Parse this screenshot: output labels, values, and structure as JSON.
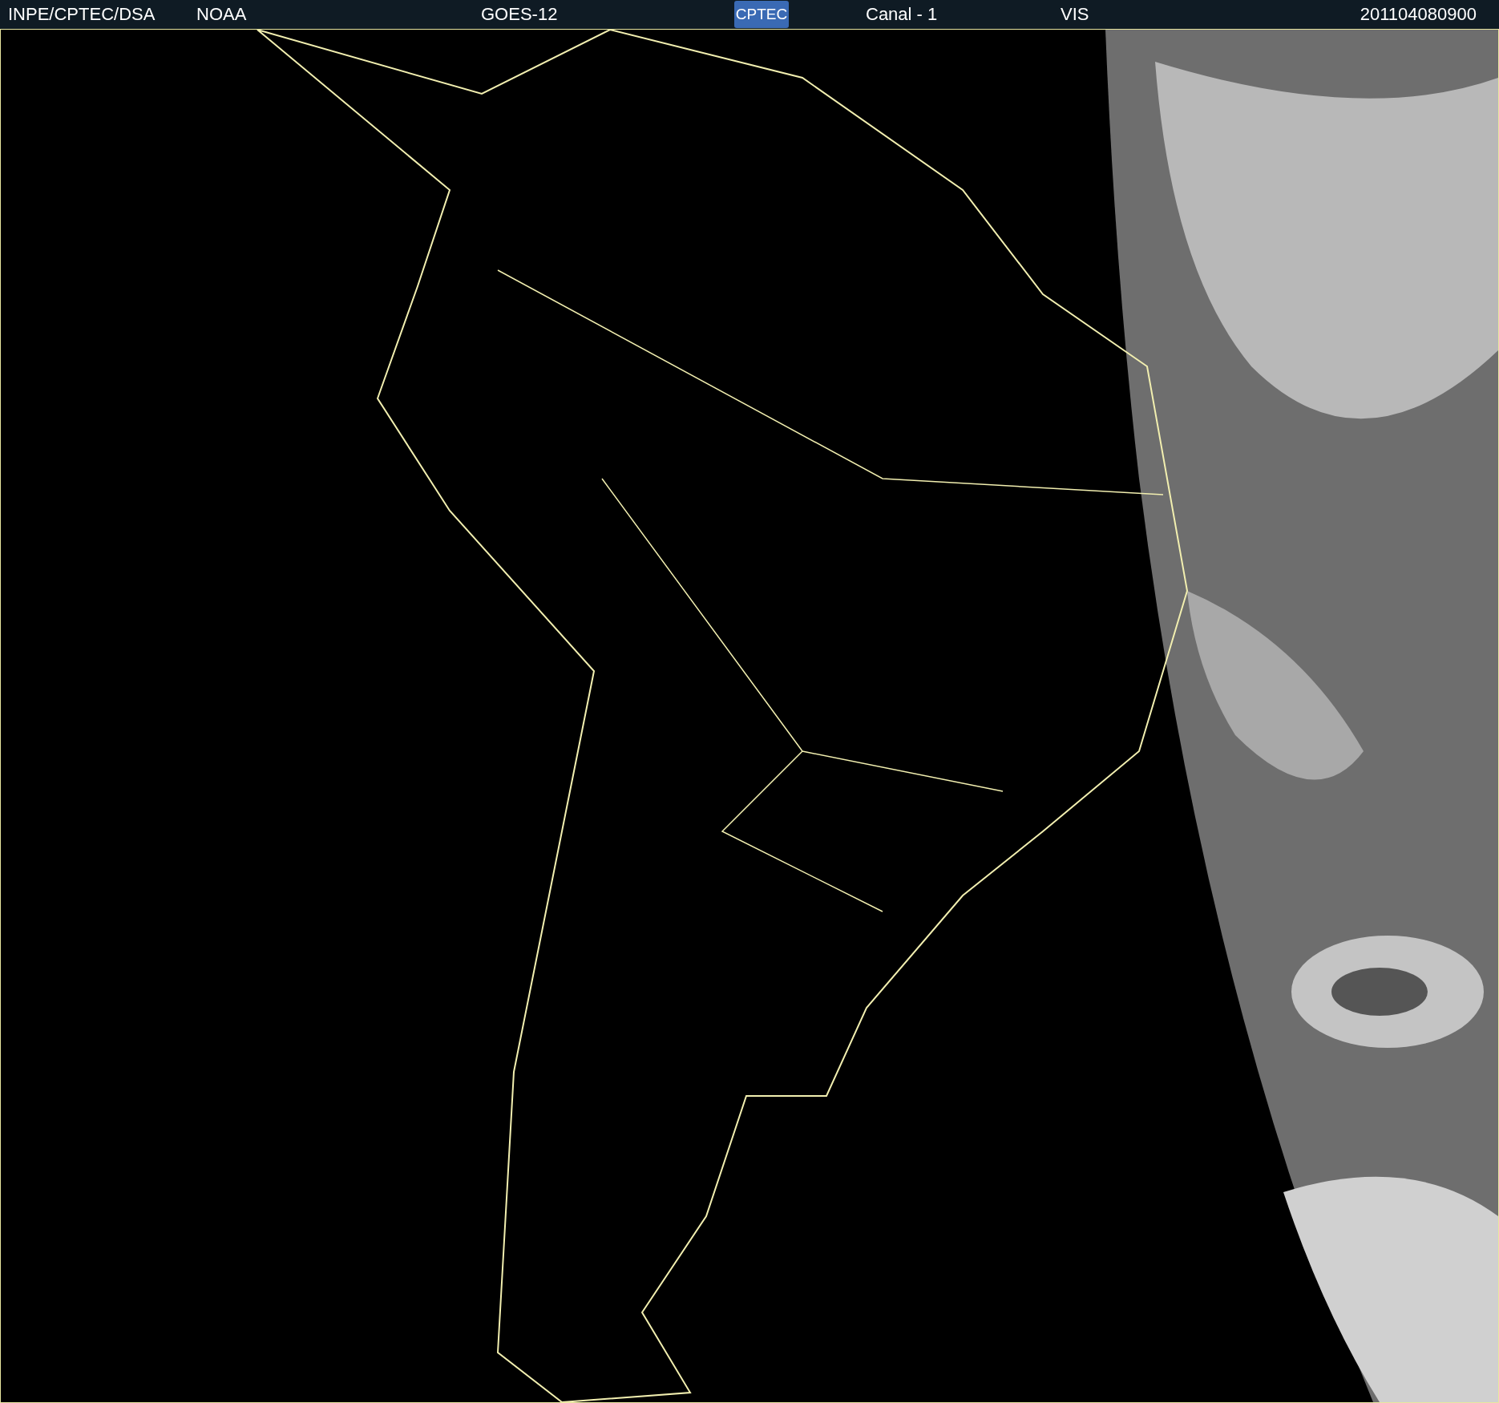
{
  "header": {
    "source": "INPE/CPTEC/DSA",
    "agency": "NOAA",
    "satellite": "GOES-12",
    "logo": "CPTEC",
    "channel": "Canal - 1",
    "band": "VIS",
    "timestamp": "201104080900"
  }
}
